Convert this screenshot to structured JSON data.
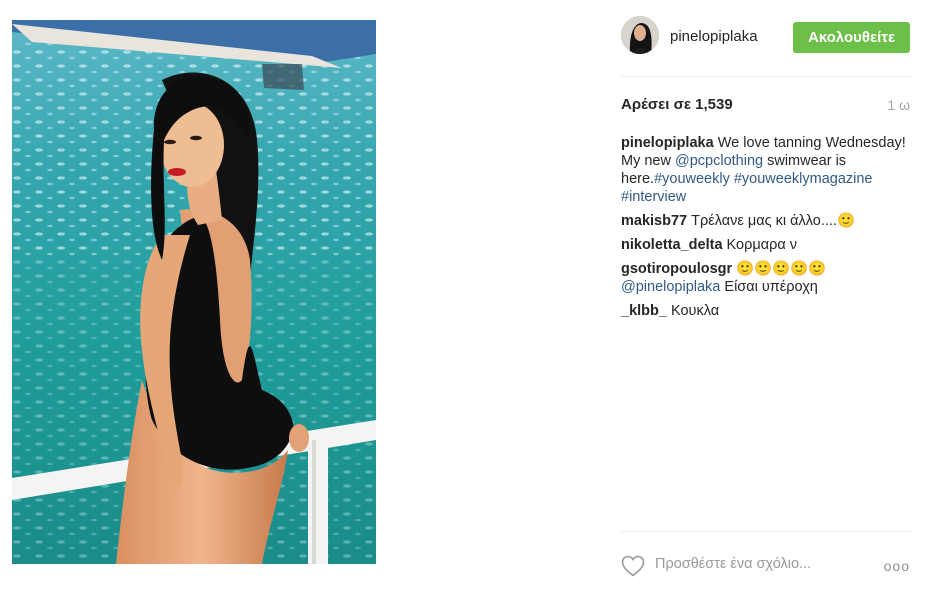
{
  "post": {
    "username": "pinelopiplaka",
    "follow_label": "Ακολουθείτε",
    "likes_label": "Αρέσει σε 1,539",
    "time": "1 ω",
    "caption": {
      "user": "pinelopiplaka",
      "text_1": " We love tanning Wednesday! My new ",
      "mention": "@pcpclothing",
      "text_2": " swimwear is here.",
      "hashtag_1": "#youweekly",
      "text_3": " ",
      "hashtag_2": "#youweeklymagazine",
      "text_4": " ",
      "hashtag_3": "#interview"
    },
    "comments": [
      {
        "user": "makisb77",
        "text": " Τρέλανε μας κι άλλο....🙂"
      },
      {
        "user": "nikoletta_delta",
        "text": " Κορμαρα ν"
      },
      {
        "user": "gsotiropoulosgr",
        "text": " 🙂🙂🙂🙂🙂",
        "mention": "@pinelopiplaka",
        "text_2": " Είσαι υπέροχη"
      },
      {
        "user": "_klbb_",
        "text": " Κουκλα"
      }
    ],
    "comment_placeholder": "Προσθέστε ένα σχόλιο...",
    "more_label": "ooo"
  },
  "icons": {
    "heart": "heart-icon",
    "more": "more-options-icon"
  },
  "colors": {
    "follow_button": "#6cc04a",
    "link": "#325a85",
    "muted": "#a5a5a5"
  }
}
